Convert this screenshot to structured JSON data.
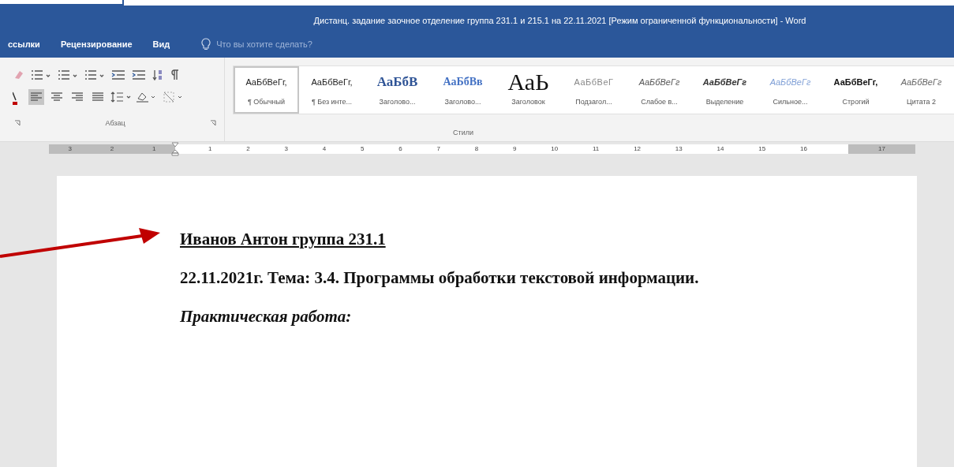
{
  "window": {
    "title": "Дистанц. задание заочное отделение группа 231.1  и 215.1 на 22.11.2021 [Режим ограниченной функциональности] - Word"
  },
  "ribbon_tabs": [
    {
      "label": "ссылки",
      "selected": false
    },
    {
      "label": "Рецензирование",
      "selected": false
    },
    {
      "label": "Вид",
      "selected": false
    }
  ],
  "tell_me": {
    "placeholder": "Что вы хотите сделать?"
  },
  "paragraph_group": {
    "label": "Абзац",
    "alignment": [
      {
        "kind": "left",
        "selected": true
      },
      {
        "kind": "center",
        "selected": false
      },
      {
        "kind": "right",
        "selected": false
      },
      {
        "kind": "justify",
        "selected": false
      }
    ]
  },
  "styles_group": {
    "label": "Стили",
    "styles": [
      {
        "sample": "АаБбВеГг,",
        "name": "¶ Обычный",
        "kind": "normal",
        "selected": true
      },
      {
        "sample": "АаБбВеГг,",
        "name": "¶ Без инте...",
        "kind": "normal",
        "selected": false
      },
      {
        "sample": "АаБбВ",
        "name": "Заголово...",
        "kind": "heading1",
        "selected": false
      },
      {
        "sample": "АаБбВв",
        "name": "Заголово...",
        "kind": "heading2",
        "selected": false
      },
      {
        "sample": "АаЬ",
        "name": "Заголовок",
        "kind": "title",
        "selected": false
      },
      {
        "sample": "АаБбВеГ",
        "name": "Подзагол...",
        "kind": "subtitle",
        "selected": false
      },
      {
        "sample": "АаБбВеГг",
        "name": "Слабое в...",
        "kind": "subtle",
        "selected": false
      },
      {
        "sample": "АаБбВеГг",
        "name": "Выделение",
        "kind": "emphasis",
        "selected": false
      },
      {
        "sample": "АаБбВеГг",
        "name": "Сильное...",
        "kind": "intense",
        "selected": false
      },
      {
        "sample": "АаБбВеГг,",
        "name": "Строгий",
        "kind": "strong",
        "selected": false
      },
      {
        "sample": "АаБбВеГг",
        "name": "Цитата 2",
        "kind": "quote",
        "selected": false
      }
    ]
  },
  "ruler": {
    "left_numbers": [
      "3",
      "2",
      "1"
    ],
    "numbers": [
      "1",
      "2",
      "3",
      "4",
      "5",
      "6",
      "7",
      "8",
      "9",
      "10",
      "11",
      "12",
      "13",
      "14",
      "15",
      "16"
    ],
    "right_numbers": [
      "17"
    ]
  },
  "document": {
    "lines": [
      {
        "text": "Иванов Антон группа 231.1",
        "kind": "underlined"
      },
      {
        "text": "22.11.2021г.  Тема: 3.4. Программы обработки текстовой информации.",
        "kind": "bold"
      },
      {
        "text": "Практическая работа:",
        "kind": "italic"
      }
    ]
  }
}
